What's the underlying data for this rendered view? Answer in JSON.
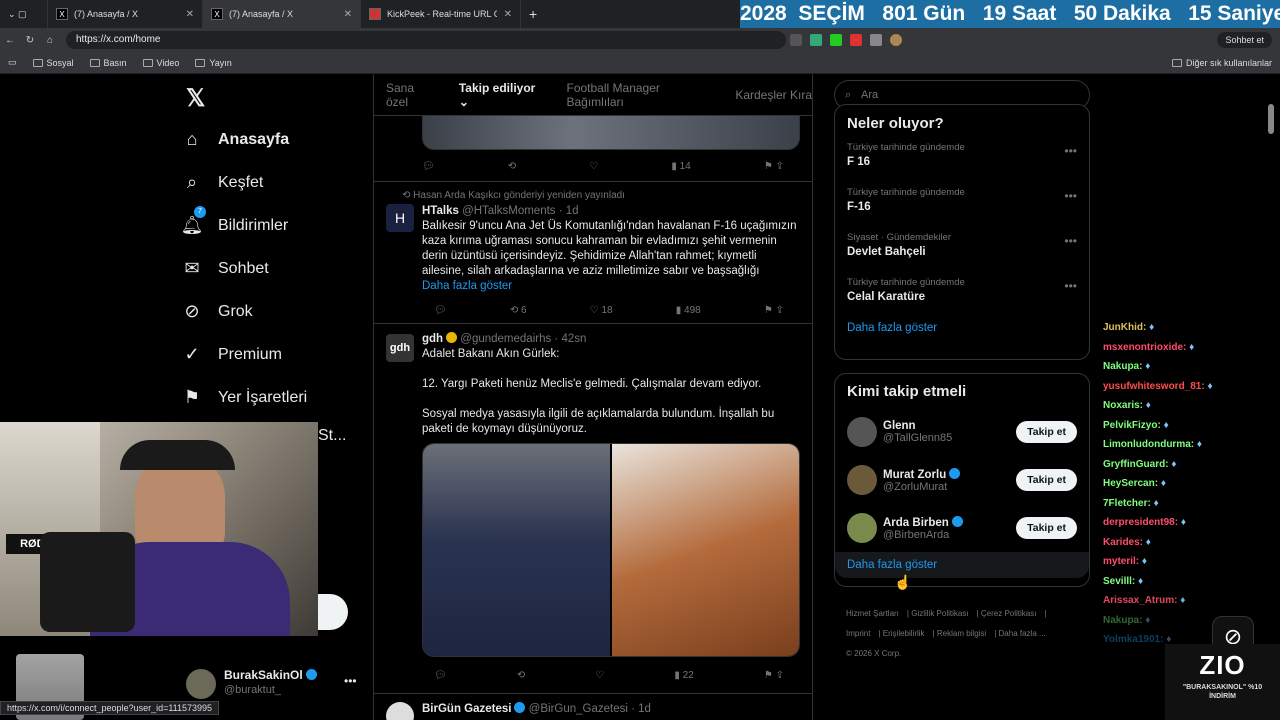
{
  "browser": {
    "tabs": [
      {
        "title": "(7) Anasayfa / X"
      },
      {
        "title": "(7) Anasayfa / X"
      },
      {
        "title": "KickPeek - Real-time URL Crawler"
      }
    ],
    "countdown": "2028  SEÇİM   801 Gün   19 Saat   50 Dakika   15 Saniye",
    "url": "https://x.com/home",
    "chat_button": "Sohbet et",
    "bookmarks": [
      "Sosyal",
      "Basın",
      "Video",
      "Yayın"
    ],
    "other_bookmarks": "Diğer sık kullanılanlar",
    "status_url": "https://x.com/i/connect_people?user_id=111573995"
  },
  "nav": {
    "items": [
      {
        "label": "Anasayfa",
        "icon": "home-icon",
        "glyph": "⌂"
      },
      {
        "label": "Keşfet",
        "icon": "search-icon",
        "glyph": "⌕"
      },
      {
        "label": "Bildirimler",
        "icon": "bell-icon",
        "glyph": "🔔︎"
      },
      {
        "label": "Sohbet",
        "icon": "mail-icon",
        "glyph": "✉"
      },
      {
        "label": "Grok",
        "icon": "grok-icon",
        "glyph": "⊘"
      },
      {
        "label": "Premium",
        "icon": "premium-icon",
        "glyph": "✓"
      },
      {
        "label": "Yer İşaretleri",
        "icon": "bookmark-icon",
        "glyph": "⚑"
      }
    ],
    "notification_badge": "7",
    "partial_label": "St...",
    "account": {
      "name": "BurakSakinOl",
      "handle": "@buraktut_"
    }
  },
  "feed": {
    "tabs": [
      "Sana özel",
      "Takip ediliyor",
      "Football Manager Bağımlıları",
      "Kardeşler Kıra"
    ],
    "top_actions": {
      "views": "14"
    },
    "tweets": [
      {
        "retweet_by": "Hasan Arda Kaşıkcı gönderiyi yeniden yayınladı",
        "name": "HTalks",
        "handle": "@HTalksMoments · 1d",
        "text": "Balıkesir 9'uncu Ana Jet Üs Komutanlığı'ndan havalanan F-16 uçağımızın kaza kırıma uğraması sonucu kahraman bir evladımızı şehit vermenin derin üzüntüsü içerisindeyiz. Şehidimize Allah'tan rahmet; kıymetli ailesine, silah arkadaşlarına ve aziz milletimize sabır ve başsağlığı",
        "more": "Daha fazla göster",
        "retweets": "6",
        "likes": "18",
        "views": "498"
      },
      {
        "name": "gdh",
        "handle": "@gundemedairhs · 42sn",
        "text1": "Adalet Bakanı Akın Gürlek:",
        "text2": "12. Yargı Paketi henüz Meclis'e gelmedi. Çalışmalar devam ediyor.",
        "text3": "Sosyal medya yasasıyla ilgili de açıklamalarda bulundum. İnşallah bu paketi de koymayı düşünüyoruz.",
        "views": "22"
      },
      {
        "name": "BirGün Gazetesi",
        "handle": "@BirGun_Gazetesi · 1d"
      }
    ]
  },
  "right": {
    "search_placeholder": "Ara",
    "trends_title": "Neler oluyor?",
    "trends": [
      {
        "meta": "Türkiye tarihinde gündemde",
        "name": "F 16"
      },
      {
        "meta": "Türkiye tarihinde gündemde",
        "name": "F-16"
      },
      {
        "meta": "Siyaset · Gündemdekiler",
        "name": "Devlet Bahçeli"
      },
      {
        "meta": "Türkiye tarihinde gündemde",
        "name": "Celal Karatüre"
      }
    ],
    "trends_more": "Daha fazla göster",
    "wtf_title": "Kimi takip etmeli",
    "who_to_follow": [
      {
        "name": "Glenn",
        "handle": "@TallGlenn85"
      },
      {
        "name": "Murat Zorlu",
        "handle": "@ZorluMurat"
      },
      {
        "name": "Arda Birben",
        "handle": "@BirbenArda"
      }
    ],
    "follow_label": "Takip et",
    "wtf_more": "Daha fazla göster",
    "footer": [
      "Hizmet Şartları",
      "Gizlilik Politikası",
      "Çerez Politikası",
      "Imprint",
      "Erişilebilirlik",
      "Reklam bilgisi",
      "Daha fazla ...",
      "© 2026 X Corp."
    ]
  },
  "chat": [
    {
      "user": "JunKhid:",
      "color": "#e0c060"
    },
    {
      "user": "msxenontrioxide:",
      "color": "#ff4d6d"
    },
    {
      "user": "Nakupa:",
      "color": "#7fff7f"
    },
    {
      "user": "yusufwhitesword_81:",
      "color": "#ff4d4d"
    },
    {
      "user": "Noxaris:",
      "color": "#7fff7f"
    },
    {
      "user": "PelvikFizyo:",
      "color": "#7fff7f"
    },
    {
      "user": "Limonludondurma:",
      "color": "#7fff7f"
    },
    {
      "user": "GryffinGuard:",
      "color": "#7fff7f"
    },
    {
      "user": "HeySercan:",
      "color": "#7fff7f"
    },
    {
      "user": "7Fletcher:",
      "color": "#7fff7f"
    },
    {
      "user": "derpresident98:",
      "color": "#ff4d6d"
    },
    {
      "user": "Karides:",
      "color": "#ff4d6d"
    },
    {
      "user": "myteril:",
      "color": "#ff4d6d"
    },
    {
      "user": "Sevilll:",
      "color": "#7fff7f"
    },
    {
      "user": "Arissax_Atrum:",
      "color": "#ff4d6d"
    },
    {
      "user": "Nakupa:",
      "color": "#7fff7f"
    },
    {
      "user": "Yolmka1901:",
      "color": "#1d9bf0"
    }
  ],
  "brand": {
    "logo": "ZIO",
    "promo": "\"BURAKSAKINOL\" %10 İNDİRİM"
  },
  "webcam": {
    "mic_label": "RØDE"
  }
}
